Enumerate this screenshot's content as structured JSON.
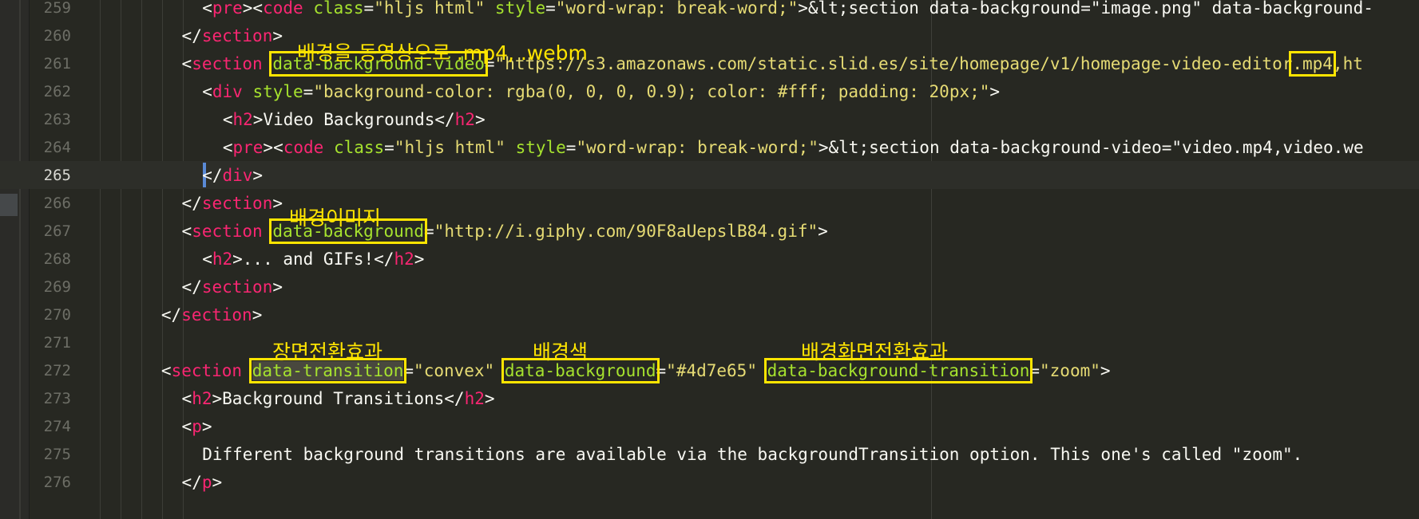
{
  "editor": {
    "current_line": 265,
    "lines": [
      {
        "num": "259",
        "indent": 10,
        "segments": [
          {
            "c": "p",
            "t": "<"
          },
          {
            "c": "t",
            "t": "pre"
          },
          {
            "c": "p",
            "t": "><"
          },
          {
            "c": "t",
            "t": "code"
          },
          {
            "c": "p",
            "t": " "
          },
          {
            "c": "a",
            "t": "class"
          },
          {
            "c": "p",
            "t": "="
          },
          {
            "c": "s",
            "t": "\"hljs html\""
          },
          {
            "c": "p",
            "t": " "
          },
          {
            "c": "a",
            "t": "style"
          },
          {
            "c": "p",
            "t": "="
          },
          {
            "c": "s",
            "t": "\"word-wrap: break-word;\""
          },
          {
            "c": "p",
            "t": ">&lt;section data-background=\"image.png\" data-background-"
          }
        ]
      },
      {
        "num": "260",
        "indent": 8,
        "segments": [
          {
            "c": "p",
            "t": "</"
          },
          {
            "c": "t",
            "t": "section"
          },
          {
            "c": "p",
            "t": ">"
          }
        ]
      },
      {
        "num": "261",
        "indent": 8,
        "segments": [
          {
            "c": "p",
            "t": "<"
          },
          {
            "c": "t",
            "t": "section"
          },
          {
            "c": "p",
            "t": " "
          },
          {
            "c": "a hl",
            "t": "data-background-video"
          },
          {
            "c": "p",
            "t": "="
          },
          {
            "c": "s",
            "t": "\"https://s3.amazonaws.com/static.slid.es/site/homepage/v1/homepage-video-editor"
          },
          {
            "c": "s hl",
            "t": ".mp4"
          },
          {
            "c": "s",
            "t": ",ht"
          }
        ]
      },
      {
        "num": "262",
        "indent": 10,
        "segments": [
          {
            "c": "p",
            "t": "<"
          },
          {
            "c": "t",
            "t": "div"
          },
          {
            "c": "p",
            "t": " "
          },
          {
            "c": "a",
            "t": "style"
          },
          {
            "c": "p",
            "t": "="
          },
          {
            "c": "s",
            "t": "\"background-color: rgba(0, 0, 0, 0.9); color: #fff; padding: 20px;\""
          },
          {
            "c": "p",
            "t": ">"
          }
        ]
      },
      {
        "num": "263",
        "indent": 12,
        "segments": [
          {
            "c": "p",
            "t": "<"
          },
          {
            "c": "t",
            "t": "h2"
          },
          {
            "c": "p",
            "t": ">Video Backgrounds</"
          },
          {
            "c": "t",
            "t": "h2"
          },
          {
            "c": "p",
            "t": ">"
          }
        ]
      },
      {
        "num": "264",
        "indent": 12,
        "segments": [
          {
            "c": "p",
            "t": "<"
          },
          {
            "c": "t",
            "t": "pre"
          },
          {
            "c": "p",
            "t": "><"
          },
          {
            "c": "t",
            "t": "code"
          },
          {
            "c": "p",
            "t": " "
          },
          {
            "c": "a",
            "t": "class"
          },
          {
            "c": "p",
            "t": "="
          },
          {
            "c": "s",
            "t": "\"hljs html\""
          },
          {
            "c": "p",
            "t": " "
          },
          {
            "c": "a",
            "t": "style"
          },
          {
            "c": "p",
            "t": "="
          },
          {
            "c": "s",
            "t": "\"word-wrap: break-word;\""
          },
          {
            "c": "p",
            "t": ">&lt;section data-background-video=\"video.mp4,video.we"
          }
        ]
      },
      {
        "num": "265",
        "indent": 10,
        "segments": [
          {
            "c": "p",
            "t": "</"
          },
          {
            "c": "t",
            "t": "div"
          },
          {
            "c": "p",
            "t": ">"
          }
        ]
      },
      {
        "num": "266",
        "indent": 8,
        "segments": [
          {
            "c": "p",
            "t": "</"
          },
          {
            "c": "t",
            "t": "section"
          },
          {
            "c": "p",
            "t": ">"
          }
        ]
      },
      {
        "num": "267",
        "indent": 8,
        "segments": [
          {
            "c": "p",
            "t": "<"
          },
          {
            "c": "t",
            "t": "section"
          },
          {
            "c": "p",
            "t": " "
          },
          {
            "c": "a hl",
            "t": "data-background"
          },
          {
            "c": "p",
            "t": "="
          },
          {
            "c": "s",
            "t": "\"http://i.giphy.com/90F8aUepslB84.gif\""
          },
          {
            "c": "p",
            "t": ">"
          }
        ]
      },
      {
        "num": "268",
        "indent": 10,
        "segments": [
          {
            "c": "p",
            "t": "<"
          },
          {
            "c": "t",
            "t": "h2"
          },
          {
            "c": "p",
            "t": ">... and GIFs!</"
          },
          {
            "c": "t",
            "t": "h2"
          },
          {
            "c": "p",
            "t": ">"
          }
        ]
      },
      {
        "num": "269",
        "indent": 8,
        "segments": [
          {
            "c": "p",
            "t": "</"
          },
          {
            "c": "t",
            "t": "section"
          },
          {
            "c": "p",
            "t": ">"
          }
        ]
      },
      {
        "num": "270",
        "indent": 6,
        "segments": [
          {
            "c": "p",
            "t": "</"
          },
          {
            "c": "t",
            "t": "section"
          },
          {
            "c": "p",
            "t": ">"
          }
        ]
      },
      {
        "num": "271",
        "indent": 0,
        "segments": []
      },
      {
        "num": "272",
        "indent": 6,
        "segments": [
          {
            "c": "p",
            "t": "<"
          },
          {
            "c": "t",
            "t": "section"
          },
          {
            "c": "p",
            "t": " "
          },
          {
            "c": "a hl sel",
            "t": "data-transition"
          },
          {
            "c": "p",
            "t": "="
          },
          {
            "c": "s",
            "t": "\"convex\""
          },
          {
            "c": "p",
            "t": " "
          },
          {
            "c": "a hl",
            "t": "data-background"
          },
          {
            "c": "p",
            "t": "="
          },
          {
            "c": "s",
            "t": "\"#4d7e65\""
          },
          {
            "c": "p",
            "t": " "
          },
          {
            "c": "a hl",
            "t": "data-background-transition"
          },
          {
            "c": "p",
            "t": "="
          },
          {
            "c": "s",
            "t": "\"zoom\""
          },
          {
            "c": "p",
            "t": ">"
          }
        ]
      },
      {
        "num": "273",
        "indent": 8,
        "segments": [
          {
            "c": "p",
            "t": "<"
          },
          {
            "c": "t",
            "t": "h2"
          },
          {
            "c": "p",
            "t": ">Background Transitions</"
          },
          {
            "c": "t",
            "t": "h2"
          },
          {
            "c": "p",
            "t": ">"
          }
        ]
      },
      {
        "num": "274",
        "indent": 8,
        "segments": [
          {
            "c": "p",
            "t": "<"
          },
          {
            "c": "t",
            "t": "p"
          },
          {
            "c": "p",
            "t": ">"
          }
        ]
      },
      {
        "num": "275",
        "indent": 10,
        "segments": [
          {
            "c": "p",
            "t": "Different background transitions are available via the backgroundTransition option. This one's called \"zoom\"."
          }
        ]
      },
      {
        "num": "276",
        "indent": 8,
        "segments": [
          {
            "c": "p",
            "t": "</"
          },
          {
            "c": "t",
            "t": "p"
          },
          {
            "c": "p",
            "t": ">"
          }
        ]
      }
    ]
  },
  "annotations": {
    "video_bg": "배경을 동영상으로 .mp4, .webm",
    "bg_image": "배경이미지",
    "transition": "장면전환효과",
    "bg_color": "배경색",
    "bg_transition": "배경화면전환효과"
  },
  "colors": {
    "background": "#272822",
    "tag": "#f92672",
    "attribute": "#a6e22e",
    "string": "#e6db74",
    "text": "#f8f8f2",
    "annotation": "#ffe500"
  }
}
